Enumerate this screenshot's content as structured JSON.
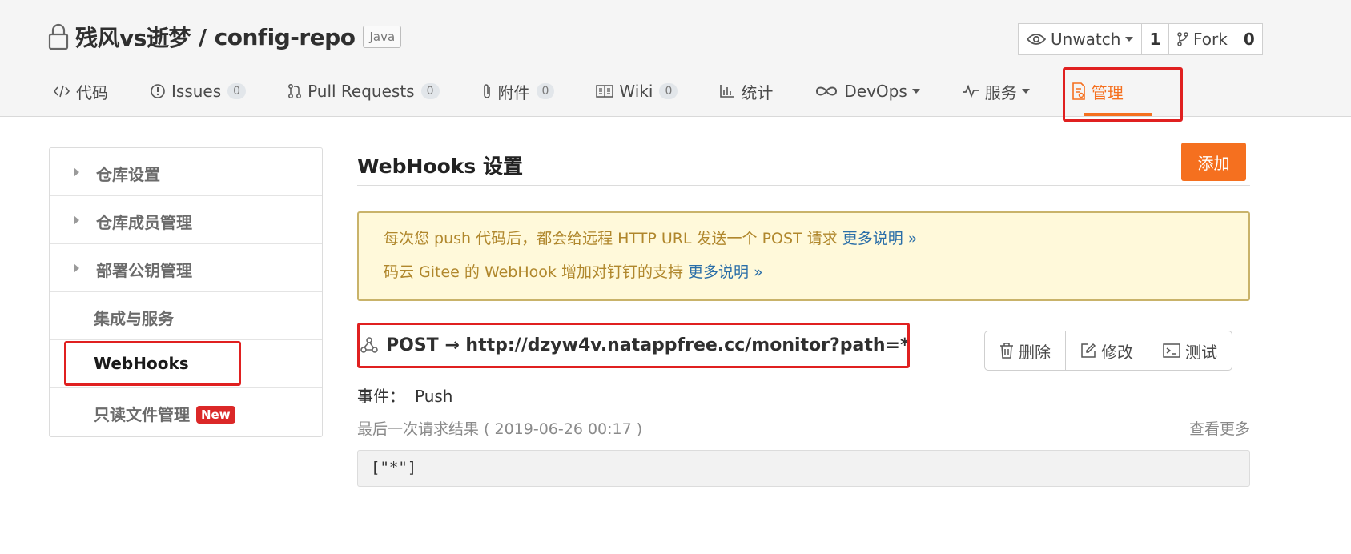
{
  "repo": {
    "owner": "残风vs逝梦",
    "separator": "/",
    "name": "config-repo",
    "language": "Java"
  },
  "actions": {
    "unwatch_label": "Unwatch",
    "unwatch_count": "1",
    "fork_label": "Fork",
    "fork_count": "0"
  },
  "nav": {
    "items": [
      {
        "label": "代码",
        "icon": "code-icon"
      },
      {
        "label": "Issues",
        "badge": "0",
        "icon": "issue-icon"
      },
      {
        "label": "Pull Requests",
        "badge": "0",
        "icon": "pull-request-icon"
      },
      {
        "label": "附件",
        "badge": "0",
        "icon": "paperclip-icon"
      },
      {
        "label": "Wiki",
        "badge": "0",
        "icon": "book-icon"
      },
      {
        "label": "统计",
        "icon": "bar-chart-icon"
      },
      {
        "label": "DevOps",
        "icon": "infinity-icon"
      },
      {
        "label": "服务",
        "icon": "pulse-icon"
      },
      {
        "label": "管理",
        "icon": "settings-doc-icon",
        "active": true
      }
    ],
    "accent": "#f5701f"
  },
  "sidebar": {
    "items": [
      {
        "label": "仓库设置"
      },
      {
        "label": "仓库成员管理"
      },
      {
        "label": "部署公钥管理"
      },
      {
        "label": "集成与服务"
      },
      {
        "label": "WebHooks"
      },
      {
        "label": "只读文件管理",
        "badge": "New"
      }
    ]
  },
  "main": {
    "title": "WebHooks 设置",
    "add_label": "添加",
    "notice": {
      "line1_text": "每次您 push 代码后，都会给远程 HTTP URL 发送一个 POST 请求",
      "line1_link": "更多说明 »",
      "line2_text": "码云 Gitee 的 WebHook 增加对钉钉的支持",
      "line2_link": "更多说明 »"
    },
    "hook": {
      "text": "POST → http://dzyw4v.natappfree.cc/monitor?path=*",
      "delete_label": "删除",
      "edit_label": "修改",
      "test_label": "测试",
      "event_label": "事件：",
      "event_value": "Push",
      "last_request": "最后一次请求结果 ( 2019-06-26 00:17 )",
      "see_more": "查看更多",
      "result": "[\"*\"]"
    }
  },
  "colors": {
    "highlight": "#e02020",
    "new_badge": "#db2828",
    "notice_bg": "#fff9da",
    "notice_text": "#b0872c",
    "link": "#2a6ea8"
  }
}
